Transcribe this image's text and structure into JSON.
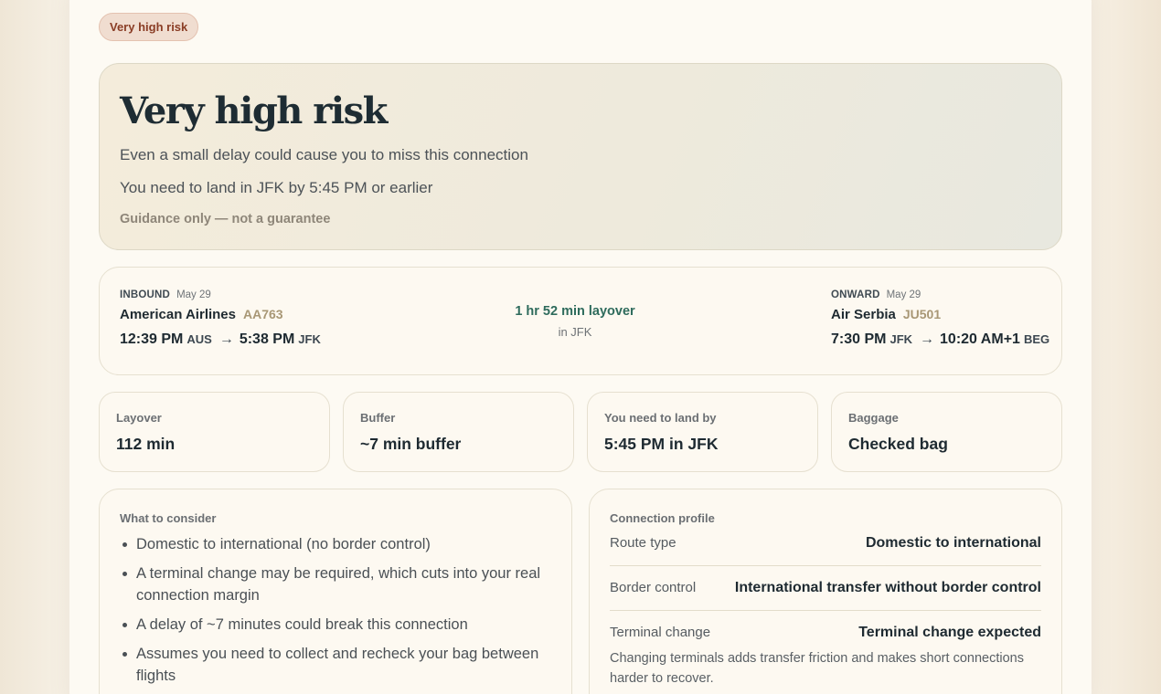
{
  "badge": "Very high risk",
  "hero": {
    "title": "Very high risk",
    "line1": "Even a small delay could cause you to miss this connection",
    "line2": "You need to land in JFK by 5:45 PM or earlier",
    "note": "Guidance only — not a guarantee"
  },
  "inbound": {
    "label": "INBOUND",
    "date": "May 29",
    "airline": "American Airlines",
    "code": "AA763",
    "dep_time": "12:39 PM",
    "dep_airport": "AUS",
    "arr_time": "5:38 PM",
    "arr_airport": "JFK"
  },
  "layover": {
    "duration": "1 hr 52 min layover",
    "location": "in JFK"
  },
  "onward": {
    "label": "ONWARD",
    "date": "May 29",
    "airline": "Air Serbia",
    "code": "JU501",
    "dep_time": "7:30 PM",
    "dep_airport": "JFK",
    "arr_time": "10:20 AM+1",
    "arr_airport": "BEG"
  },
  "arrow": "→",
  "stats": [
    {
      "label": "Layover",
      "value": "112 min"
    },
    {
      "label": "Buffer",
      "value": "~7 min buffer"
    },
    {
      "label": "You need to land by",
      "value": "5:45 PM in JFK"
    },
    {
      "label": "Baggage",
      "value": "Checked bag"
    }
  ],
  "consider": {
    "title": "What to consider",
    "items": [
      "Domestic to international (no border control)",
      "A terminal change may be required, which cuts into your real connection margin",
      "A delay of ~7 minutes could break this connection",
      "Assumes you need to collect and recheck your bag between flights"
    ]
  },
  "profile": {
    "title": "Connection profile",
    "rows": [
      {
        "key": "Route type",
        "value": "Domestic to international"
      },
      {
        "key": "Border control",
        "value": "International transfer without border control"
      },
      {
        "key": "Terminal change",
        "value": "Terminal change expected"
      }
    ],
    "description": "Changing terminals adds transfer friction and makes short connections harder to recover."
  }
}
